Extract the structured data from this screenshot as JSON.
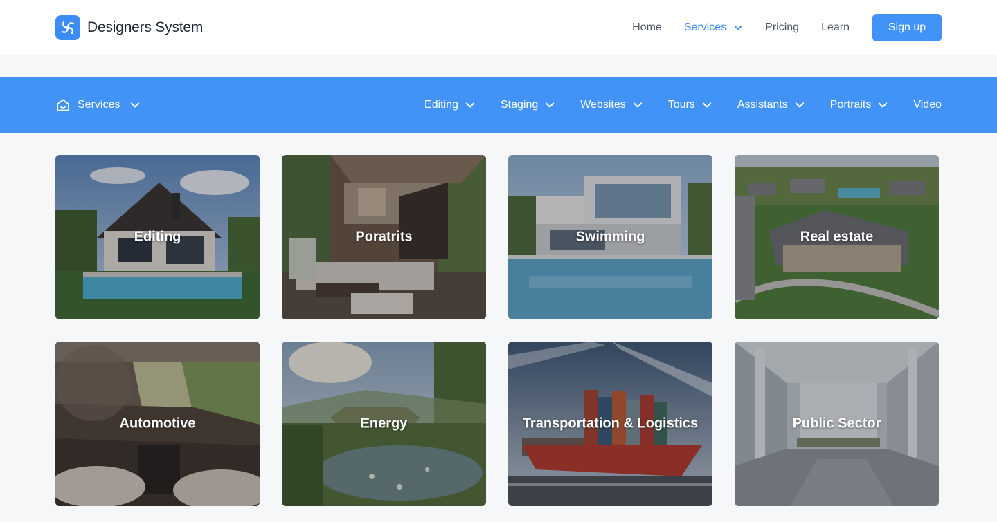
{
  "header": {
    "brand_name": "Designers System",
    "nav": [
      {
        "label": "Home"
      },
      {
        "label": "Services",
        "active": true,
        "has_dropdown": true
      },
      {
        "label": "Pricing"
      },
      {
        "label": "Learn"
      }
    ],
    "signup_label": "Sign up"
  },
  "subnav": {
    "services_label": "Services",
    "items": [
      {
        "label": "Editing"
      },
      {
        "label": "Staging"
      },
      {
        "label": "Websites"
      },
      {
        "label": "Tours"
      },
      {
        "label": "Assistants"
      },
      {
        "label": "Portraits"
      },
      {
        "label": "Video"
      }
    ]
  },
  "cards": [
    {
      "label": "Editing",
      "image": "modern-house-pool"
    },
    {
      "label": "Poratrits",
      "image": "luxury-living-room"
    },
    {
      "label": "Swimming",
      "image": "villa-swimming-pool"
    },
    {
      "label": "Real estate",
      "image": "aerial-neighborhood"
    },
    {
      "label": "Automotive",
      "image": "car-interior"
    },
    {
      "label": "Energy",
      "image": "pond-landscape"
    },
    {
      "label": "Transportation & Logistics",
      "image": "container-ship"
    },
    {
      "label": "Public Sector",
      "image": "public-hall-interior"
    }
  ],
  "colors": {
    "primary": "#4193f7",
    "active_text": "#3b8df5",
    "page_bg": "#f6f7f9",
    "header_bg": "#ffffff"
  },
  "icons": {
    "brand": "swirl-logo-icon",
    "subnav_home": "home-icon",
    "dropdown": "chevron-down-icon"
  }
}
